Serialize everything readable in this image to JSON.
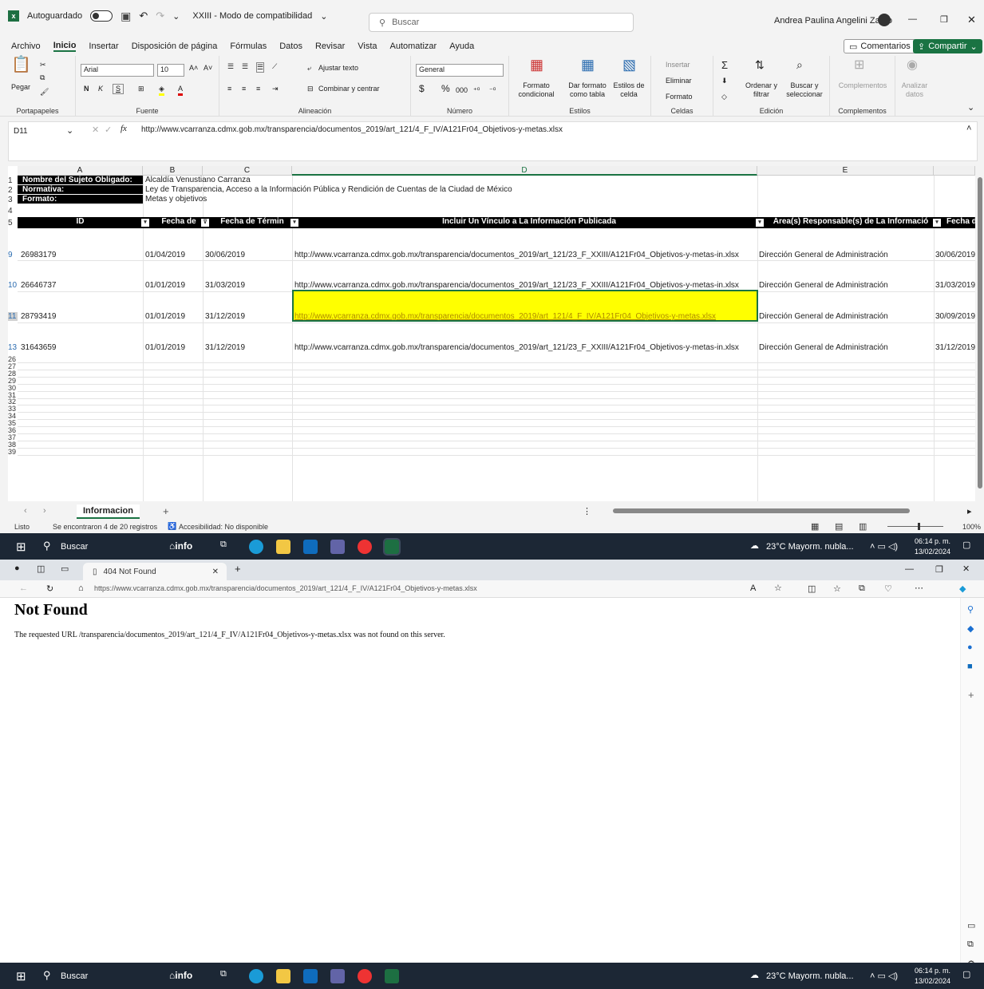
{
  "excel": {
    "autosave": "Autoguardado",
    "filename": "XXIII - Modo de compatibilidad",
    "search": "Buscar",
    "user": "Andrea Paulina Angelini Zarzo",
    "menu": [
      "Archivo",
      "Inicio",
      "Insertar",
      "Disposición de página",
      "Fórmulas",
      "Datos",
      "Revisar",
      "Vista",
      "Automatizar",
      "Ayuda"
    ],
    "comments": "Comentarios",
    "share": "Compartir",
    "ribbon": {
      "paste": "Pegar",
      "clipboard": "Portapapeles",
      "font": "Arial",
      "size": "10",
      "font_group": "Fuente",
      "wrap": "Ajustar texto",
      "merge": "Combinar y centrar",
      "align_group": "Alineación",
      "numfmt": "General",
      "num_group": "Número",
      "cond": "Formato condicional",
      "table": "Dar formato como tabla",
      "cellstyles": "Estilos de celda",
      "styles_group": "Estilos",
      "insert": "Insertar",
      "delete": "Eliminar",
      "format": "Formato",
      "cells_group": "Celdas",
      "sort": "Ordenar y filtrar",
      "find": "Buscar y seleccionar",
      "edit_group": "Edición",
      "addins": "Complementos",
      "analyze": "Analizar datos",
      "addins_group": "Complementos"
    },
    "namebox": "D11",
    "formula": "http://www.vcarranza.cdmx.gob.mx/transparencia/documentos_2019/art_121/4_F_IV/A121Fr04_Objetivos-y-metas.xlsx",
    "cols": [
      "A",
      "B",
      "C",
      "D",
      "E"
    ],
    "info": [
      {
        "n": "1",
        "label": "Nombre del Sujeto Obligado:",
        "value": "Alcaldía Venustiano Carranza"
      },
      {
        "n": "2",
        "label": "Normativa:",
        "value": "Ley de Transparencia, Acceso a la Información Pública y Rendición de Cuentas de la Ciudad de México"
      },
      {
        "n": "3",
        "label": "Formato:",
        "value": "Metas y objetivos"
      }
    ],
    "headers": [
      "ID",
      "Fecha de",
      "Fecha de Términ",
      "Incluir Un Vínculo a La Información Publicada",
      "Área(s) Responsable(s) de La Informació",
      "Fecha de"
    ],
    "rows": [
      {
        "n": "9",
        "id": "26983179",
        "b": "01/04/2019",
        "c": "30/06/2019",
        "d": "http://www.vcarranza.cdmx.gob.mx/transparencia/documentos_2019/art_121/23_F_XXIII/A121Fr04_Objetivos-y-metas-in.xlsx",
        "e": "Dirección General de Administración",
        "f": "30/06/2019"
      },
      {
        "n": "10",
        "id": "26646737",
        "b": "01/01/2019",
        "c": "31/03/2019",
        "d": "http://www.vcarranza.cdmx.gob.mx/transparencia/documentos_2019/art_121/23_F_XXIII/A121Fr04_Objetivos-y-metas-in.xlsx",
        "e": "Dirección General de Administración",
        "f": "31/03/2019"
      },
      {
        "n": "11",
        "id": "28793419",
        "b": "01/01/2019",
        "c": "31/12/2019",
        "d": "http://www.vcarranza.cdmx.gob.mx/transparencia/documentos_2019/art_121/4_F_IV/A121Fr04_Objetivos-y-metas.xlsx",
        "e": "Dirección General de Administración",
        "f": "30/09/2019"
      },
      {
        "n": "13",
        "id": "31643659",
        "b": "01/01/2019",
        "c": "31/12/2019",
        "d": "http://www.vcarranza.cdmx.gob.mx/transparencia/documentos_2019/art_121/23_F_XXIII/A121Fr04_Objetivos-y-metas-in.xlsx",
        "e": "Dirección General de Administración",
        "f": "31/12/2019"
      }
    ],
    "empty_rows": [
      "26",
      "27",
      "28",
      "29",
      "30",
      "31",
      "32",
      "33",
      "34",
      "35",
      "36",
      "37",
      "38",
      "39"
    ],
    "sheet": "Informacion",
    "status": {
      "ready": "Listo",
      "found": "Se encontraron 4 de 20 registros",
      "access": "Accesibilidad: No disponible",
      "zoom": "100%"
    }
  },
  "taskbar": {
    "search": "Buscar",
    "weather": "23°C  Mayorm. nubla...",
    "time": "06:14 p. m.",
    "date": "13/02/2024"
  },
  "browser": {
    "tab": "404 Not Found",
    "url": "https://www.vcarranza.cdmx.gob.mx/transparencia/documentos_2019/art_121/4_F_IV/A121Fr04_Objetivos-y-metas.xlsx",
    "title": "Not Found",
    "message": "The requested URL /transparencia/documentos_2019/art_121/4_F_IV/A121Fr04_Objetivos-y-metas.xlsx was not found on this server."
  },
  "taskbar2": {
    "search": "Buscar",
    "weather": "23°C  Mayorm. nubla...",
    "time": "06:14 p. m.",
    "date": "13/02/2024"
  }
}
